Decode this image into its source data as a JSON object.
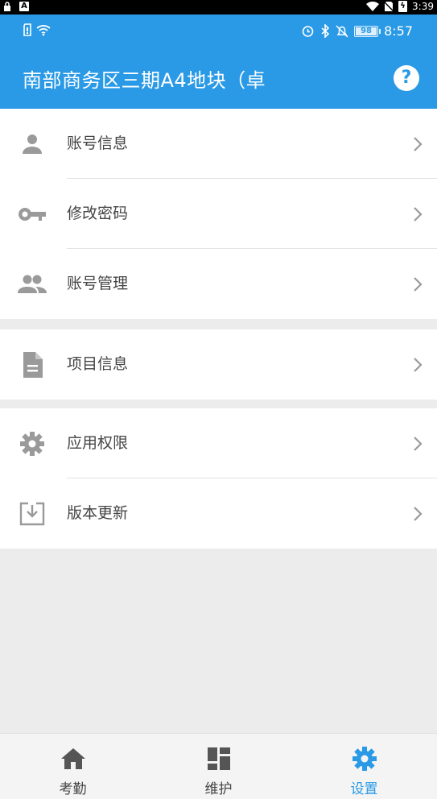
{
  "system_bar": {
    "time": "3:39"
  },
  "app_status": {
    "time": "8:57",
    "battery": "98"
  },
  "header": {
    "title": "南部商务区三期A4地块（卓",
    "help": "?"
  },
  "groups": [
    {
      "items": [
        {
          "label": "账号信息",
          "icon": "person-icon"
        },
        {
          "label": "修改密码",
          "icon": "key-icon"
        },
        {
          "label": "账号管理",
          "icon": "people-icon"
        }
      ]
    },
    {
      "items": [
        {
          "label": "项目信息",
          "icon": "document-icon"
        }
      ]
    },
    {
      "items": [
        {
          "label": "应用权限",
          "icon": "gear-icon"
        },
        {
          "label": "版本更新",
          "icon": "download-icon"
        }
      ]
    }
  ],
  "tabs": [
    {
      "label": "考勤",
      "icon": "home-icon",
      "active": false
    },
    {
      "label": "维护",
      "icon": "dashboard-icon",
      "active": false
    },
    {
      "label": "设置",
      "icon": "gear-icon",
      "active": true
    }
  ],
  "colors": {
    "primary": "#2a9ae6",
    "icon_gray": "#9a9a9a",
    "background": "#ececec"
  }
}
